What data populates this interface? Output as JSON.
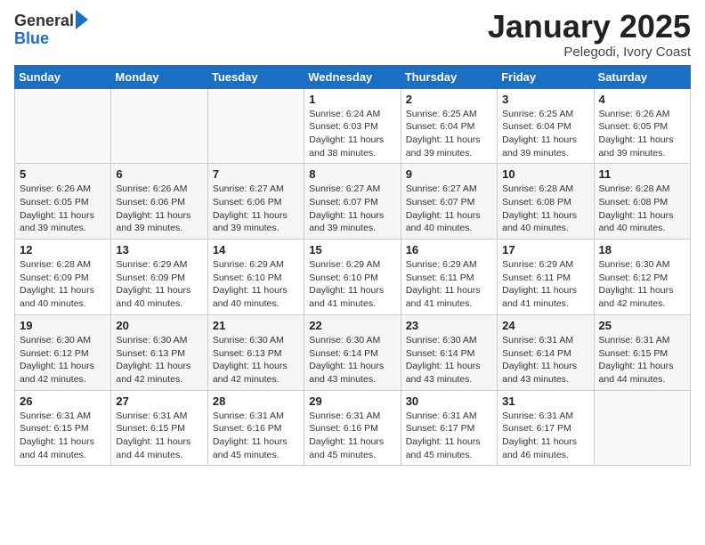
{
  "logo": {
    "general": "General",
    "blue": "Blue"
  },
  "title": {
    "month_year": "January 2025",
    "location": "Pelegodi, Ivory Coast"
  },
  "weekdays": [
    "Sunday",
    "Monday",
    "Tuesday",
    "Wednesday",
    "Thursday",
    "Friday",
    "Saturday"
  ],
  "weeks": [
    [
      {
        "day": "",
        "info": ""
      },
      {
        "day": "",
        "info": ""
      },
      {
        "day": "",
        "info": ""
      },
      {
        "day": "1",
        "info": "Sunrise: 6:24 AM\nSunset: 6:03 PM\nDaylight: 11 hours and 38 minutes."
      },
      {
        "day": "2",
        "info": "Sunrise: 6:25 AM\nSunset: 6:04 PM\nDaylight: 11 hours and 39 minutes."
      },
      {
        "day": "3",
        "info": "Sunrise: 6:25 AM\nSunset: 6:04 PM\nDaylight: 11 hours and 39 minutes."
      },
      {
        "day": "4",
        "info": "Sunrise: 6:26 AM\nSunset: 6:05 PM\nDaylight: 11 hours and 39 minutes."
      }
    ],
    [
      {
        "day": "5",
        "info": "Sunrise: 6:26 AM\nSunset: 6:05 PM\nDaylight: 11 hours and 39 minutes."
      },
      {
        "day": "6",
        "info": "Sunrise: 6:26 AM\nSunset: 6:06 PM\nDaylight: 11 hours and 39 minutes."
      },
      {
        "day": "7",
        "info": "Sunrise: 6:27 AM\nSunset: 6:06 PM\nDaylight: 11 hours and 39 minutes."
      },
      {
        "day": "8",
        "info": "Sunrise: 6:27 AM\nSunset: 6:07 PM\nDaylight: 11 hours and 39 minutes."
      },
      {
        "day": "9",
        "info": "Sunrise: 6:27 AM\nSunset: 6:07 PM\nDaylight: 11 hours and 40 minutes."
      },
      {
        "day": "10",
        "info": "Sunrise: 6:28 AM\nSunset: 6:08 PM\nDaylight: 11 hours and 40 minutes."
      },
      {
        "day": "11",
        "info": "Sunrise: 6:28 AM\nSunset: 6:08 PM\nDaylight: 11 hours and 40 minutes."
      }
    ],
    [
      {
        "day": "12",
        "info": "Sunrise: 6:28 AM\nSunset: 6:09 PM\nDaylight: 11 hours and 40 minutes."
      },
      {
        "day": "13",
        "info": "Sunrise: 6:29 AM\nSunset: 6:09 PM\nDaylight: 11 hours and 40 minutes."
      },
      {
        "day": "14",
        "info": "Sunrise: 6:29 AM\nSunset: 6:10 PM\nDaylight: 11 hours and 40 minutes."
      },
      {
        "day": "15",
        "info": "Sunrise: 6:29 AM\nSunset: 6:10 PM\nDaylight: 11 hours and 41 minutes."
      },
      {
        "day": "16",
        "info": "Sunrise: 6:29 AM\nSunset: 6:11 PM\nDaylight: 11 hours and 41 minutes."
      },
      {
        "day": "17",
        "info": "Sunrise: 6:29 AM\nSunset: 6:11 PM\nDaylight: 11 hours and 41 minutes."
      },
      {
        "day": "18",
        "info": "Sunrise: 6:30 AM\nSunset: 6:12 PM\nDaylight: 11 hours and 42 minutes."
      }
    ],
    [
      {
        "day": "19",
        "info": "Sunrise: 6:30 AM\nSunset: 6:12 PM\nDaylight: 11 hours and 42 minutes."
      },
      {
        "day": "20",
        "info": "Sunrise: 6:30 AM\nSunset: 6:13 PM\nDaylight: 11 hours and 42 minutes."
      },
      {
        "day": "21",
        "info": "Sunrise: 6:30 AM\nSunset: 6:13 PM\nDaylight: 11 hours and 42 minutes."
      },
      {
        "day": "22",
        "info": "Sunrise: 6:30 AM\nSunset: 6:14 PM\nDaylight: 11 hours and 43 minutes."
      },
      {
        "day": "23",
        "info": "Sunrise: 6:30 AM\nSunset: 6:14 PM\nDaylight: 11 hours and 43 minutes."
      },
      {
        "day": "24",
        "info": "Sunrise: 6:31 AM\nSunset: 6:14 PM\nDaylight: 11 hours and 43 minutes."
      },
      {
        "day": "25",
        "info": "Sunrise: 6:31 AM\nSunset: 6:15 PM\nDaylight: 11 hours and 44 minutes."
      }
    ],
    [
      {
        "day": "26",
        "info": "Sunrise: 6:31 AM\nSunset: 6:15 PM\nDaylight: 11 hours and 44 minutes."
      },
      {
        "day": "27",
        "info": "Sunrise: 6:31 AM\nSunset: 6:15 PM\nDaylight: 11 hours and 44 minutes."
      },
      {
        "day": "28",
        "info": "Sunrise: 6:31 AM\nSunset: 6:16 PM\nDaylight: 11 hours and 45 minutes."
      },
      {
        "day": "29",
        "info": "Sunrise: 6:31 AM\nSunset: 6:16 PM\nDaylight: 11 hours and 45 minutes."
      },
      {
        "day": "30",
        "info": "Sunrise: 6:31 AM\nSunset: 6:17 PM\nDaylight: 11 hours and 45 minutes."
      },
      {
        "day": "31",
        "info": "Sunrise: 6:31 AM\nSunset: 6:17 PM\nDaylight: 11 hours and 46 minutes."
      },
      {
        "day": "",
        "info": ""
      }
    ]
  ]
}
